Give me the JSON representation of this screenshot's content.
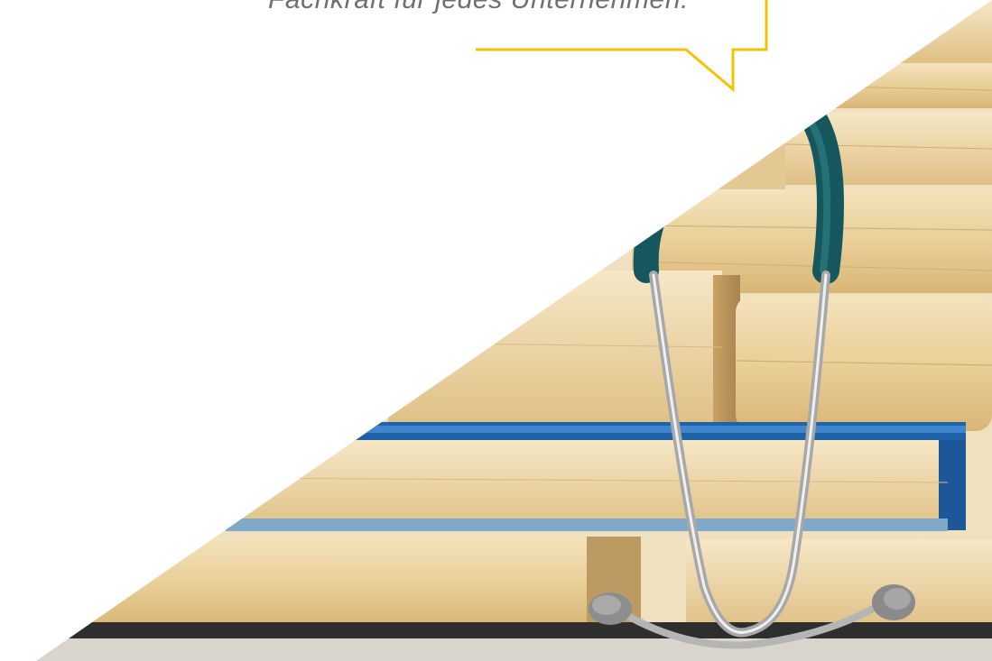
{
  "testimonial": {
    "quote_fragment": "Fachkraft für jedes Unternehmen."
  },
  "colors": {
    "bubble_border": "#f3c200",
    "quote_text": "#6f6f6f",
    "background": "#ffffff"
  },
  "image": {
    "subject": "stethoscope-resting-on-stack-of-books"
  }
}
